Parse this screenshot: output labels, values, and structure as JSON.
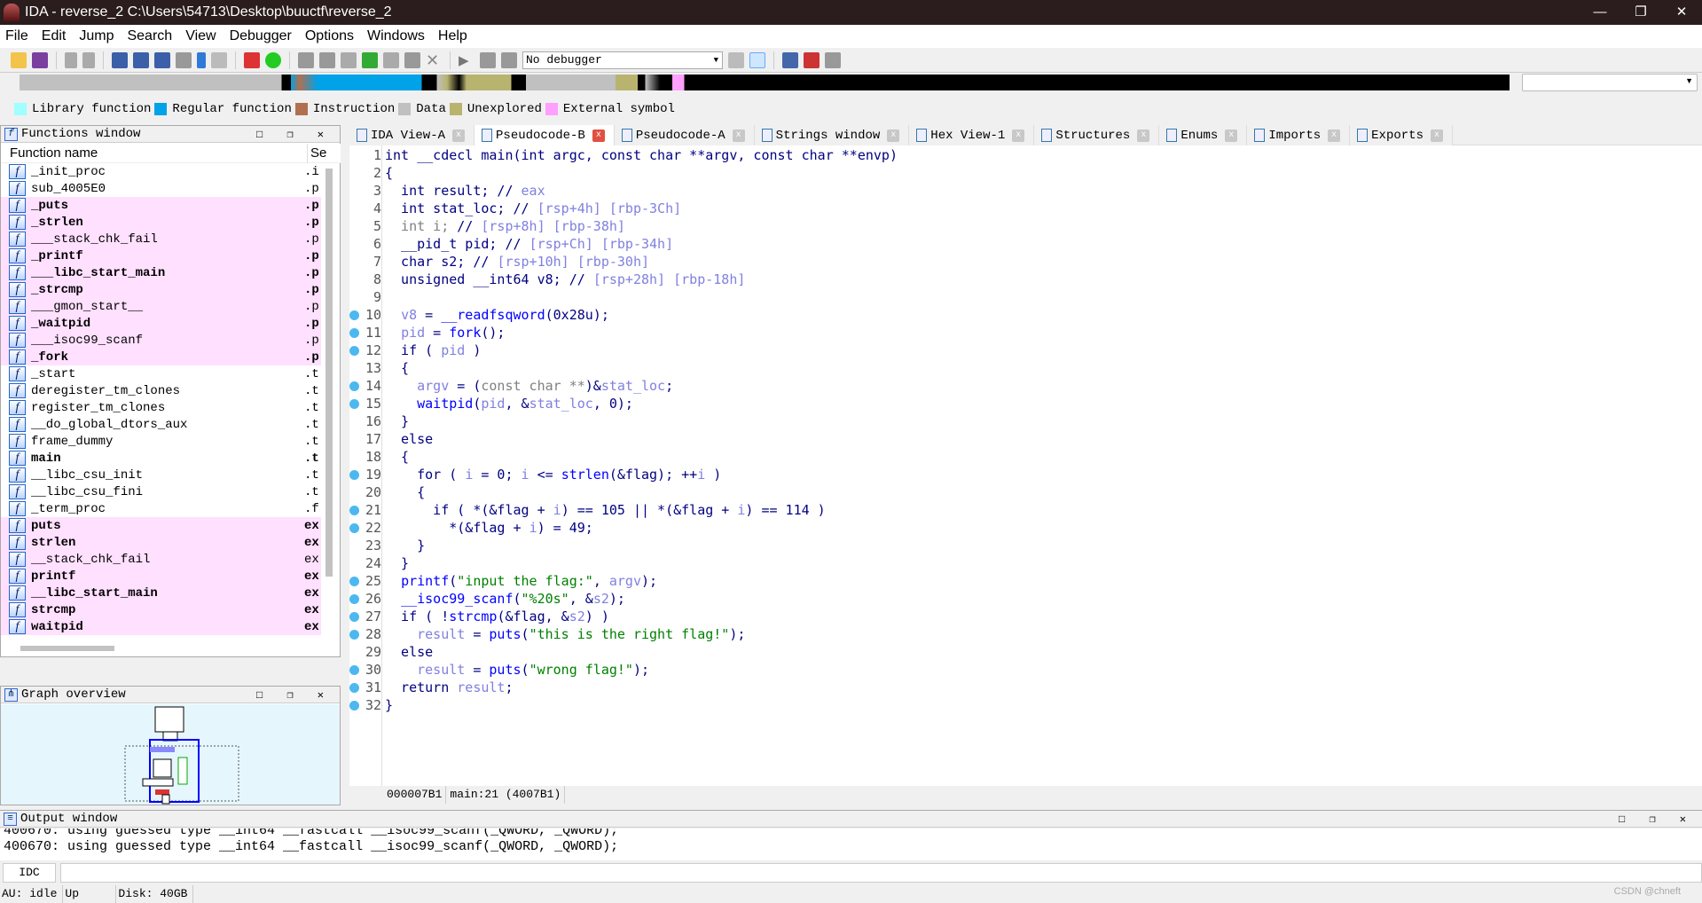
{
  "window": {
    "title": "IDA - reverse_2 C:\\Users\\54713\\Desktop\\buuctf\\reverse_2",
    "minimize": "—",
    "restore": "❐",
    "close": "✕"
  },
  "menu": [
    "File",
    "Edit",
    "Jump",
    "Search",
    "View",
    "Debugger",
    "Options",
    "Windows",
    "Help"
  ],
  "toolbar": {
    "debugger_select": "No debugger"
  },
  "legend": [
    {
      "label": "Library function",
      "color": "#a0ffff"
    },
    {
      "label": "Regular function",
      "color": "#00a2e8"
    },
    {
      "label": "Instruction",
      "color": "#b07050"
    },
    {
      "label": "Data",
      "color": "#c0c0c0"
    },
    {
      "label": "Unexplored",
      "color": "#b8b470"
    },
    {
      "label": "External symbol",
      "color": "#ffa0ff"
    }
  ],
  "functions_window": {
    "title": "Functions window",
    "col_name": "Function name",
    "col_segment": "Se",
    "rows": [
      {
        "name": "_init_proc",
        "seg": ".i",
        "bold": false,
        "ext": false
      },
      {
        "name": "sub_4005E0",
        "seg": ".p",
        "bold": false,
        "ext": false
      },
      {
        "name": "_puts",
        "seg": ".p",
        "bold": true,
        "ext": true
      },
      {
        "name": "_strlen",
        "seg": ".p",
        "bold": true,
        "ext": true
      },
      {
        "name": "___stack_chk_fail",
        "seg": ".p",
        "bold": false,
        "ext": true
      },
      {
        "name": "_printf",
        "seg": ".p",
        "bold": true,
        "ext": true
      },
      {
        "name": "___libc_start_main",
        "seg": ".p",
        "bold": true,
        "ext": true
      },
      {
        "name": "_strcmp",
        "seg": ".p",
        "bold": true,
        "ext": true
      },
      {
        "name": "___gmon_start__",
        "seg": ".p",
        "bold": false,
        "ext": true
      },
      {
        "name": "_waitpid",
        "seg": ".p",
        "bold": true,
        "ext": true
      },
      {
        "name": "___isoc99_scanf",
        "seg": ".p",
        "bold": false,
        "ext": true
      },
      {
        "name": "_fork",
        "seg": ".p",
        "bold": true,
        "ext": true
      },
      {
        "name": "_start",
        "seg": ".t",
        "bold": false,
        "ext": false
      },
      {
        "name": "deregister_tm_clones",
        "seg": ".t",
        "bold": false,
        "ext": false
      },
      {
        "name": "register_tm_clones",
        "seg": ".t",
        "bold": false,
        "ext": false
      },
      {
        "name": "__do_global_dtors_aux",
        "seg": ".t",
        "bold": false,
        "ext": false
      },
      {
        "name": "frame_dummy",
        "seg": ".t",
        "bold": false,
        "ext": false
      },
      {
        "name": "main",
        "seg": ".t",
        "bold": true,
        "ext": false
      },
      {
        "name": "__libc_csu_init",
        "seg": ".t",
        "bold": false,
        "ext": false
      },
      {
        "name": "__libc_csu_fini",
        "seg": ".t",
        "bold": false,
        "ext": false
      },
      {
        "name": "_term_proc",
        "seg": ".f",
        "bold": false,
        "ext": false
      },
      {
        "name": "puts",
        "seg": "ex",
        "bold": true,
        "ext": true
      },
      {
        "name": "strlen",
        "seg": "ex",
        "bold": true,
        "ext": true
      },
      {
        "name": "__stack_chk_fail",
        "seg": "ex",
        "bold": false,
        "ext": true
      },
      {
        "name": "printf",
        "seg": "ex",
        "bold": true,
        "ext": true
      },
      {
        "name": "__libc_start_main",
        "seg": "ex",
        "bold": true,
        "ext": true
      },
      {
        "name": "strcmp",
        "seg": "ex",
        "bold": true,
        "ext": true
      },
      {
        "name": "waitpid",
        "seg": "ex",
        "bold": true,
        "ext": true
      }
    ]
  },
  "graph_overview": {
    "title": "Graph overview"
  },
  "tabs": [
    {
      "label": "IDA View-A",
      "active": false
    },
    {
      "label": "Pseudocode-B",
      "active": true
    },
    {
      "label": "Pseudocode-A",
      "active": false
    },
    {
      "label": "Strings window",
      "active": false
    },
    {
      "label": "Hex View-1",
      "active": false
    },
    {
      "label": "Structures",
      "active": false
    },
    {
      "label": "Enums",
      "active": false
    },
    {
      "label": "Imports",
      "active": false
    },
    {
      "label": "Exports",
      "active": false
    }
  ],
  "code": [
    {
      "n": "1",
      "bp": false,
      "t": [
        [
          "int __cdecl main(int argc, const char **argv, const char **envp)",
          "k"
        ]
      ]
    },
    {
      "n": "2",
      "bp": false,
      "t": [
        [
          "{",
          "k"
        ]
      ]
    },
    {
      "n": "3",
      "bp": false,
      "t": [
        [
          "  int result; // ",
          "k"
        ],
        [
          "eax",
          "c"
        ]
      ]
    },
    {
      "n": "4",
      "bp": false,
      "t": [
        [
          "  int stat_loc; // ",
          "k"
        ],
        [
          "[rsp+4h] [rbp-3Ch]",
          "c"
        ]
      ]
    },
    {
      "n": "5",
      "bp": false,
      "t": [
        [
          "  int i; ",
          "g"
        ],
        [
          "// ",
          "k"
        ],
        [
          "[rsp+8h] [rbp-38h]",
          "c"
        ]
      ]
    },
    {
      "n": "6",
      "bp": false,
      "t": [
        [
          "  __pid_t pid; // ",
          "k"
        ],
        [
          "[rsp+Ch] [rbp-34h]",
          "c"
        ]
      ]
    },
    {
      "n": "7",
      "bp": false,
      "t": [
        [
          "  char s2; // ",
          "k"
        ],
        [
          "[rsp+10h] [rbp-30h]",
          "c"
        ]
      ]
    },
    {
      "n": "8",
      "bp": false,
      "t": [
        [
          "  unsigned __int64 v8; // ",
          "k"
        ],
        [
          "[rsp+28h] [rbp-18h]",
          "c"
        ]
      ]
    },
    {
      "n": "9",
      "bp": false,
      "t": [
        [
          "",
          "k"
        ]
      ]
    },
    {
      "n": "10",
      "bp": true,
      "t": [
        [
          "  ",
          "k"
        ],
        [
          "v8",
          "v"
        ],
        [
          " = ",
          "k"
        ],
        [
          "__readfsqword",
          "f"
        ],
        [
          "(0x28u);",
          "k"
        ]
      ]
    },
    {
      "n": "11",
      "bp": true,
      "t": [
        [
          "  ",
          "k"
        ],
        [
          "pid",
          "v"
        ],
        [
          " = ",
          "k"
        ],
        [
          "fork",
          "f"
        ],
        [
          "();",
          "k"
        ]
      ]
    },
    {
      "n": "12",
      "bp": true,
      "t": [
        [
          "  if ( ",
          "k"
        ],
        [
          "pid",
          "v"
        ],
        [
          " )",
          "k"
        ]
      ]
    },
    {
      "n": "13",
      "bp": false,
      "t": [
        [
          "  {",
          "k"
        ]
      ]
    },
    {
      "n": "14",
      "bp": true,
      "t": [
        [
          "    ",
          "k"
        ],
        [
          "argv",
          "v"
        ],
        [
          " = (",
          "k"
        ],
        [
          "const char **",
          "g"
        ],
        [
          ")&",
          "k"
        ],
        [
          "stat_loc",
          "v"
        ],
        [
          ";",
          "k"
        ]
      ]
    },
    {
      "n": "15",
      "bp": true,
      "t": [
        [
          "    ",
          "k"
        ],
        [
          "waitpid",
          "f"
        ],
        [
          "(",
          "k"
        ],
        [
          "pid",
          "v"
        ],
        [
          ", &",
          "k"
        ],
        [
          "stat_loc",
          "v"
        ],
        [
          ", 0);",
          "k"
        ]
      ]
    },
    {
      "n": "16",
      "bp": false,
      "t": [
        [
          "  }",
          "k"
        ]
      ]
    },
    {
      "n": "17",
      "bp": false,
      "t": [
        [
          "  else",
          "k"
        ]
      ]
    },
    {
      "n": "18",
      "bp": false,
      "t": [
        [
          "  {",
          "k"
        ]
      ]
    },
    {
      "n": "19",
      "bp": true,
      "t": [
        [
          "    for ( ",
          "k"
        ],
        [
          "i",
          "v"
        ],
        [
          " = 0; ",
          "k"
        ],
        [
          "i",
          "v"
        ],
        [
          " <= ",
          "k"
        ],
        [
          "strlen",
          "f"
        ],
        [
          "(&flag); ++",
          "k"
        ],
        [
          "i",
          "v"
        ],
        [
          " )",
          "k"
        ]
      ]
    },
    {
      "n": "20",
      "bp": false,
      "t": [
        [
          "    {",
          "k"
        ]
      ]
    },
    {
      "n": "21",
      "bp": true,
      "t": [
        [
          "      if ( *(&flag + ",
          "k"
        ],
        [
          "i",
          "v"
        ],
        [
          ") == 105 || *(&flag + ",
          "k"
        ],
        [
          "i",
          "v"
        ],
        [
          ") == 114 )",
          "k"
        ]
      ]
    },
    {
      "n": "22",
      "bp": true,
      "t": [
        [
          "        *(&flag + ",
          "k"
        ],
        [
          "i",
          "v"
        ],
        [
          ") = 49;",
          "k"
        ]
      ]
    },
    {
      "n": "23",
      "bp": false,
      "t": [
        [
          "    }",
          "k"
        ]
      ]
    },
    {
      "n": "24",
      "bp": false,
      "t": [
        [
          "  }",
          "k"
        ]
      ]
    },
    {
      "n": "25",
      "bp": true,
      "t": [
        [
          "  ",
          "k"
        ],
        [
          "printf",
          "f"
        ],
        [
          "(",
          "k"
        ],
        [
          "\"input the flag:\"",
          "s"
        ],
        [
          ", ",
          "k"
        ],
        [
          "argv",
          "v"
        ],
        [
          ");",
          "k"
        ]
      ]
    },
    {
      "n": "26",
      "bp": true,
      "t": [
        [
          "  ",
          "k"
        ],
        [
          "__isoc99_scanf",
          "f"
        ],
        [
          "(",
          "k"
        ],
        [
          "\"%20s\"",
          "s"
        ],
        [
          ", &",
          "k"
        ],
        [
          "s2",
          "v"
        ],
        [
          ");",
          "k"
        ]
      ]
    },
    {
      "n": "27",
      "bp": true,
      "t": [
        [
          "  if ( !",
          "k"
        ],
        [
          "strcmp",
          "f"
        ],
        [
          "(&flag, &",
          "k"
        ],
        [
          "s2",
          "v"
        ],
        [
          ") )",
          "k"
        ]
      ]
    },
    {
      "n": "28",
      "bp": true,
      "t": [
        [
          "    ",
          "k"
        ],
        [
          "result",
          "v"
        ],
        [
          " = ",
          "k"
        ],
        [
          "puts",
          "f"
        ],
        [
          "(",
          "k"
        ],
        [
          "\"this is the right flag!\"",
          "s"
        ],
        [
          ");",
          "k"
        ]
      ]
    },
    {
      "n": "29",
      "bp": false,
      "t": [
        [
          "  else",
          "k"
        ]
      ]
    },
    {
      "n": "30",
      "bp": true,
      "t": [
        [
          "    ",
          "k"
        ],
        [
          "result",
          "v"
        ],
        [
          " = ",
          "k"
        ],
        [
          "puts",
          "f"
        ],
        [
          "(",
          "k"
        ],
        [
          "\"wrong flag!\"",
          "s"
        ],
        [
          ");",
          "k"
        ]
      ]
    },
    {
      "n": "31",
      "bp": true,
      "t": [
        [
          "  return ",
          "k"
        ],
        [
          "result",
          "v"
        ],
        [
          ";",
          "k"
        ]
      ]
    },
    {
      "n": "32",
      "bp": true,
      "t": [
        [
          "}",
          "k"
        ]
      ]
    }
  ],
  "code_status": [
    "000007B1",
    "main:21 (4007B1)"
  ],
  "output_window": {
    "title": "Output window",
    "lines": [
      "400670: using guessed type __int64 __fastcall __isoc99_scanf(_QWORD, _QWORD);",
      "400670: using guessed type __int64 __fastcall __isoc99_scanf(_QWORD, _QWORD);"
    ]
  },
  "idc": {
    "label": "IDC",
    "value": ""
  },
  "statusbar": [
    "AU:  idle",
    "Up",
    "Disk: 40GB"
  ],
  "watermark": "CSDN @chneft",
  "panel_controls": "□ ❐ ✕"
}
